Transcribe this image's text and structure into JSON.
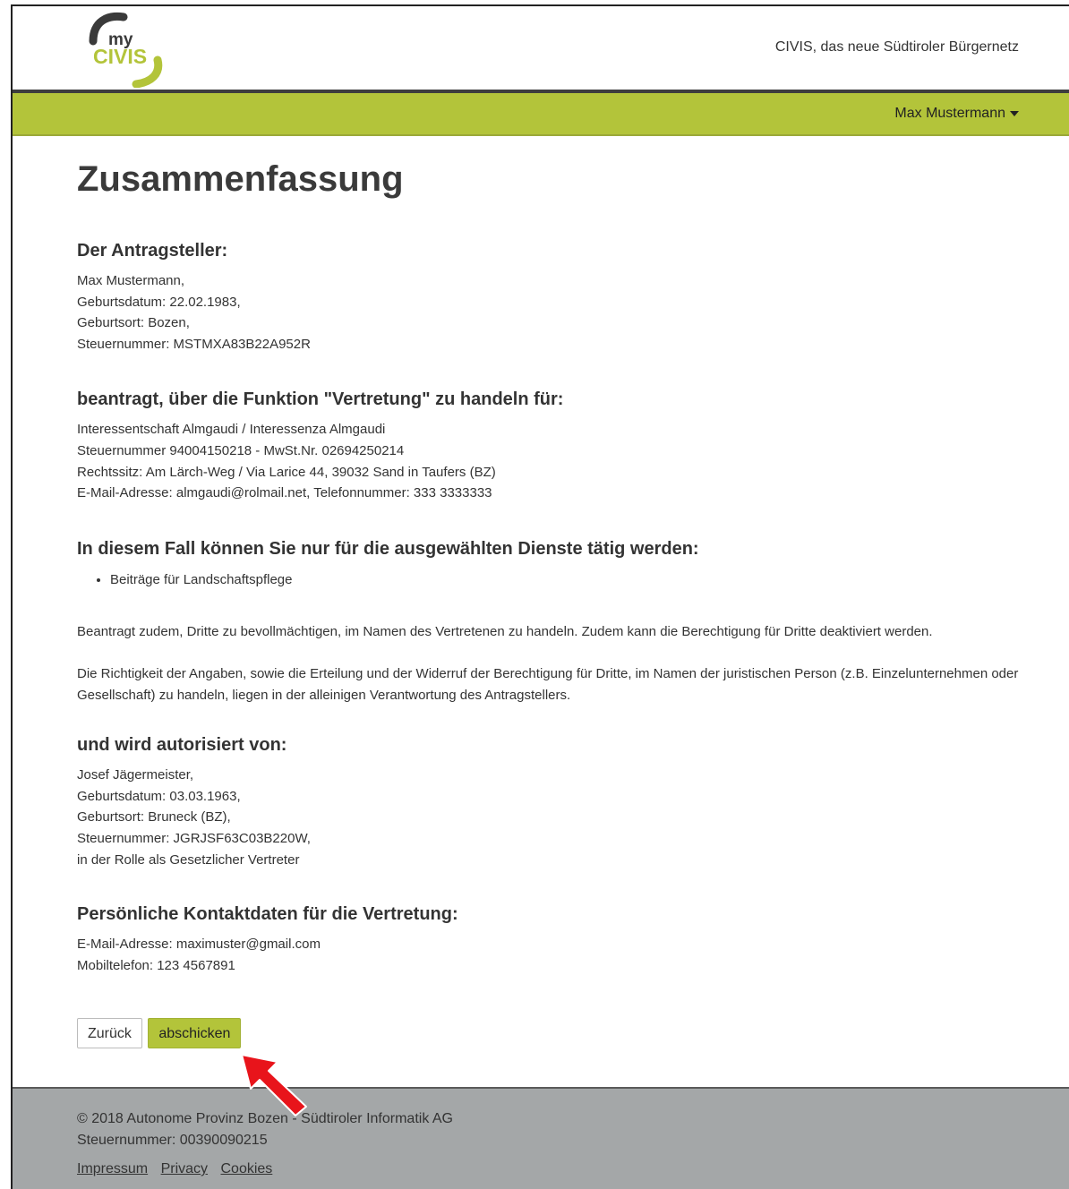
{
  "header": {
    "logo_text_top": "my",
    "logo_text_bottom": "CIVIS",
    "tagline": "CIVIS, das neue Südtiroler Bürgernetz"
  },
  "nav": {
    "user_name": "Max Mustermann"
  },
  "main": {
    "title": "Zusammenfassung",
    "applicant": {
      "heading": "Der Antragsteller:",
      "lines": [
        "Max Mustermann,",
        "Geburtsdatum: 22.02.1983,",
        "Geburtsort: Bozen,",
        "Steuernummer: MSTMXA83B22A952R"
      ]
    },
    "represent": {
      "heading": "beantragt, über die Funktion \"Vertretung\" zu handeln für:",
      "lines": [
        "Interessentschaft Almgaudi / Interessenza Almgaudi",
        "Steuernummer 94004150218 - MwSt.Nr. 02694250214",
        "Rechtssitz: Am Lärch-Weg / Via Larice 44, 39032 Sand in Taufers (BZ)",
        "E-Mail-Adresse: almgaudi@rolmail.net, Telefonnummer: 333 3333333"
      ]
    },
    "services": {
      "heading": "In diesem Fall können Sie nur für die ausgewählten Dienste tätig werden:",
      "items": [
        "Beiträge für Landschaftspflege"
      ]
    },
    "paragraph1": "Beantragt zudem, Dritte zu bevollmächtigen, im Namen des Vertretenen zu handeln. Zudem kann die Berechtigung für Dritte deaktiviert werden.",
    "paragraph2": "Die Richtigkeit der Angaben, sowie die Erteilung und der Widerruf der Berechtigung für Dritte, im Namen der juristischen Person (z.B. Einzelunternehmen oder Gesellschaft) zu handeln, liegen in der alleinigen Verantwortung des Antragstellers.",
    "authorized": {
      "heading": "und wird autorisiert von:",
      "lines": [
        "Josef Jägermeister,",
        "Geburtsdatum: 03.03.1963,",
        "Geburtsort: Bruneck (BZ),",
        "Steuernummer: JGRJSF63C03B220W,",
        "in der Rolle als Gesetzlicher Vertreter"
      ]
    },
    "contact": {
      "heading": "Persönliche Kontaktdaten für die Vertretung:",
      "lines": [
        "E-Mail-Adresse: maximuster@gmail.com",
        "Mobiltelefon: 123 4567891"
      ]
    },
    "buttons": {
      "back": "Zurück",
      "submit": "abschicken"
    }
  },
  "footer": {
    "lines": [
      "© 2018 Autonome Provinz Bozen - Südtiroler Informatik AG",
      "Steuernummer: 00390090215"
    ],
    "links": [
      "Impressum",
      "Privacy",
      "Cookies"
    ]
  },
  "colors": {
    "brand_green": "#b3c43a",
    "dark_bar": "#3e3e3e",
    "footer_bg": "#a4a7a8",
    "annotation_arrow": "#e8141b"
  }
}
